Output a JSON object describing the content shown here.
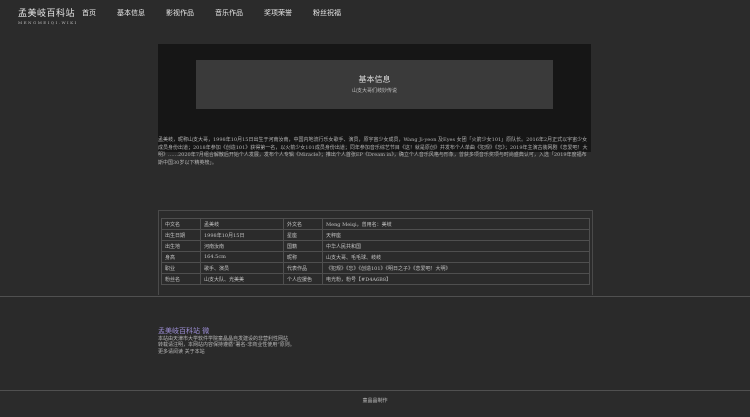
{
  "nav": {
    "logo_title": "孟美岐百科站",
    "logo_sub": "MENGMEIQI.WIKI",
    "links": [
      "首页",
      "基本信息",
      "影视作品",
      "音乐作品",
      "奖项荣誉",
      "粉丝祝福"
    ]
  },
  "hero": {
    "title": "基本信息",
    "subtitle": "山支大哥们岐妙传说"
  },
  "bio": "孟美岐，昵称山支大哥，1998年10月15日出生于河南汝南，中国内地流行乐女歌手、演员，原宇宙少女成员，Wang Ji-yeon 及Eyes 女团「火箭少女101」原队长。2016年2月正式以宇宙少女成员身份出道；2018年参加《创造101》获得第一名，以火箭少女101成员身份出道；同年参加音乐综艺节目《这！就是原创》并发布个人单曲《犯规》《忘》；2019年主演古装网剧《恋爱吧！大明》……2020年7月组合解散后开始个人发展，发布个人专辑《Miracle》；推出个人首张EP《Dream in》，确立个人音乐风格与形象，曾获多项音乐奖项与时尚盛典认可，入选「2019年度福布斯中国30岁以下精英榜」。",
  "info": {
    "rows": [
      [
        "中文名",
        "孟美岐",
        "外文名",
        "Meng Meiqi，曾用名：美岐"
      ],
      [
        "出生日期",
        "1998年10月15日",
        "星座",
        "天秤座"
      ],
      [
        "出生地",
        "河南汝南",
        "国籍",
        "中华人民共和国"
      ],
      [
        "身高",
        "164.5cm",
        "昵称",
        "山支大哥、毛毛球、岐岐"
      ],
      [
        "职业",
        "歌手、演员",
        "代表作品",
        "《犯规》《忘》《创造101》《明日之子》《恋爱吧！大明》"
      ],
      [
        "粉丝名",
        "山支大队、光美美",
        "个人应援色",
        "电光粉，粉号【#D4A6B8】"
      ]
    ]
  },
  "footer": {
    "title": "孟美岐百科站 微",
    "lines": [
      "本站由天津市大学软件学院童晶晶自发建设的非营利性网站",
      "转载请注明，本网站内容保持遵循“署名-非商业性使用”原则。",
      "更多请阅读 关于本站"
    ]
  },
  "bottom": "童晶晶制作"
}
